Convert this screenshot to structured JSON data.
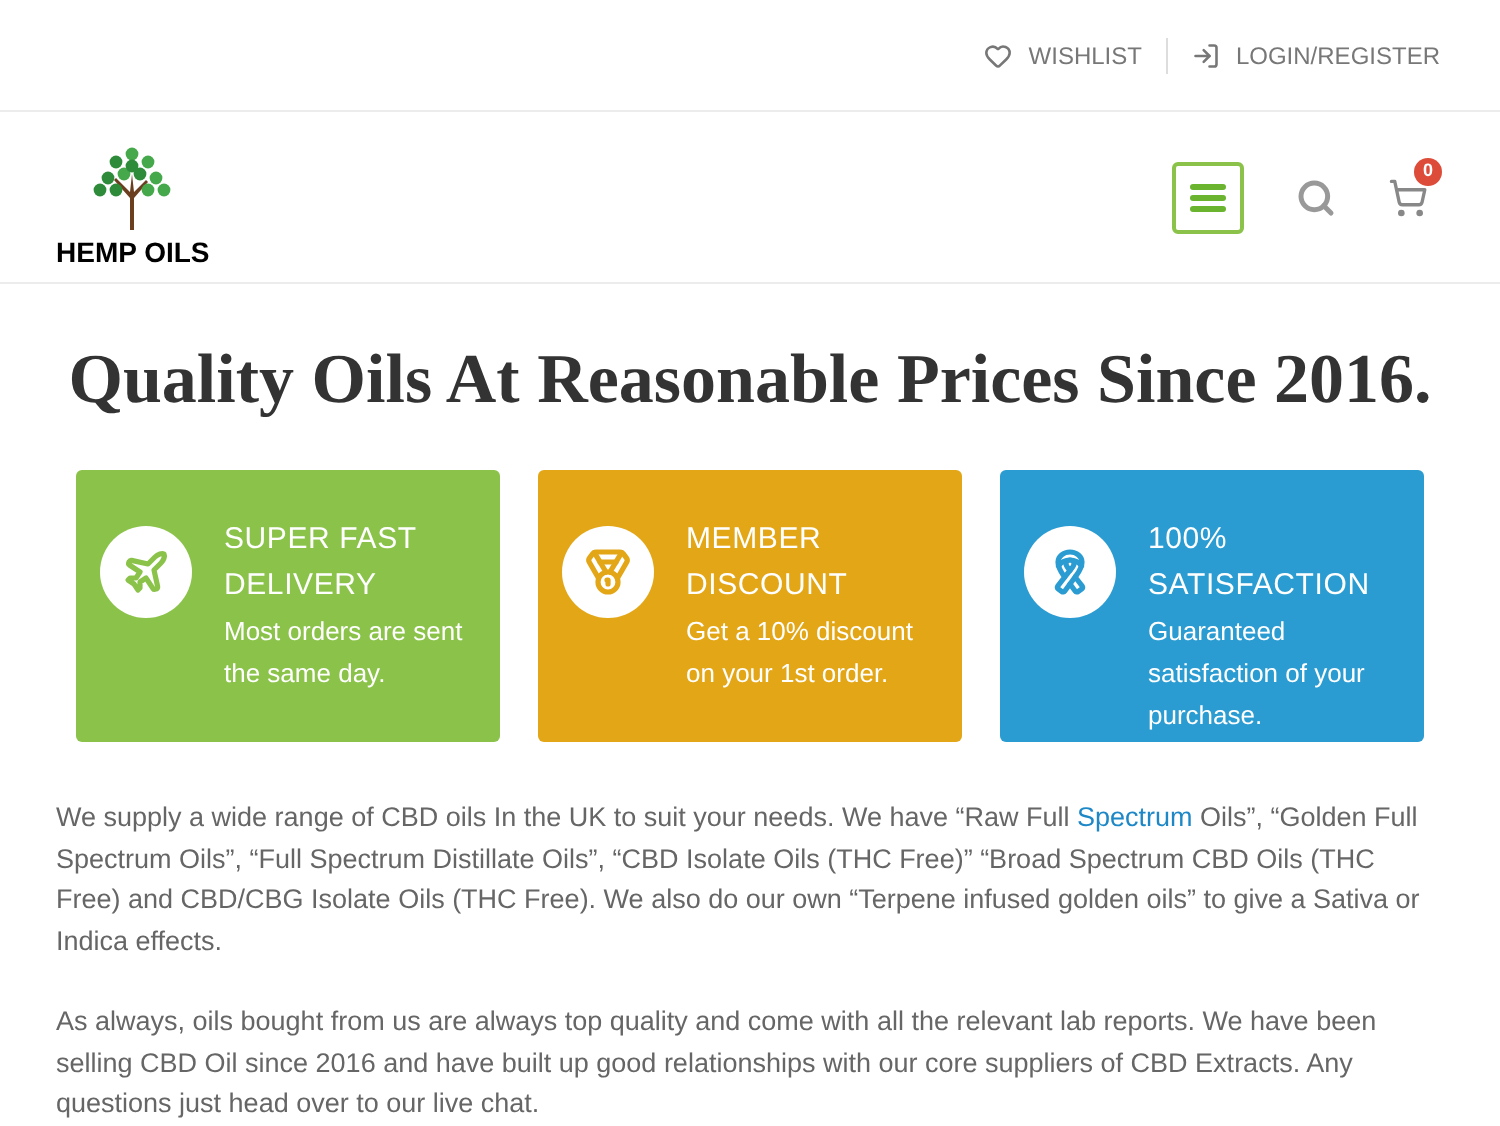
{
  "top_bar": {
    "links": [
      {
        "kind": "heart",
        "label": "WISHLIST"
      },
      {
        "kind": "login",
        "label": "LOGIN/REGISTER"
      }
    ]
  },
  "header": {
    "logo_text": "HEMP OILS",
    "cart_count": "0"
  },
  "heading": "Quality Oils At Reasonable Prices Since 2016.",
  "features": [
    {
      "kind": "plane",
      "color": "#8bc34a",
      "title": "SUPER FAST DELIVERY",
      "text": "Most orders are sent the same day."
    },
    {
      "kind": "medal",
      "color": "#e3a617",
      "title": "MEMBER DISCOUNT",
      "text": "Get a 10% discount on your 1st order."
    },
    {
      "kind": "ribbon",
      "color": "#2b9cd2",
      "title": "100% SATISFACTION",
      "text": "Guaranteed satisfaction of your purchase."
    }
  ],
  "paragraphs": [
    {
      "before": "We supply a wide range of CBD oils In the UK to suit your needs. We have “Raw Full ",
      "link": "Spectrum",
      "after": " Oils”, “Golden Full Spectrum Oils”, “Full Spectrum Distillate Oils”, “CBD Isolate Oils (THC Free)” “Broad Spectrum CBD Oils (THC Free) and CBD/CBG Isolate Oils (THC Free). We also do our own “Terpene infused golden oils” to give a Sativa or Indica effects."
    },
    {
      "before": "As always, oils bought from us are always top quality and come with all the relevant lab reports. We have been selling CBD Oil since 2016 and have built up good relationships with our core suppliers of CBD Extracts. Any questions just head over to our live chat."
    }
  ]
}
